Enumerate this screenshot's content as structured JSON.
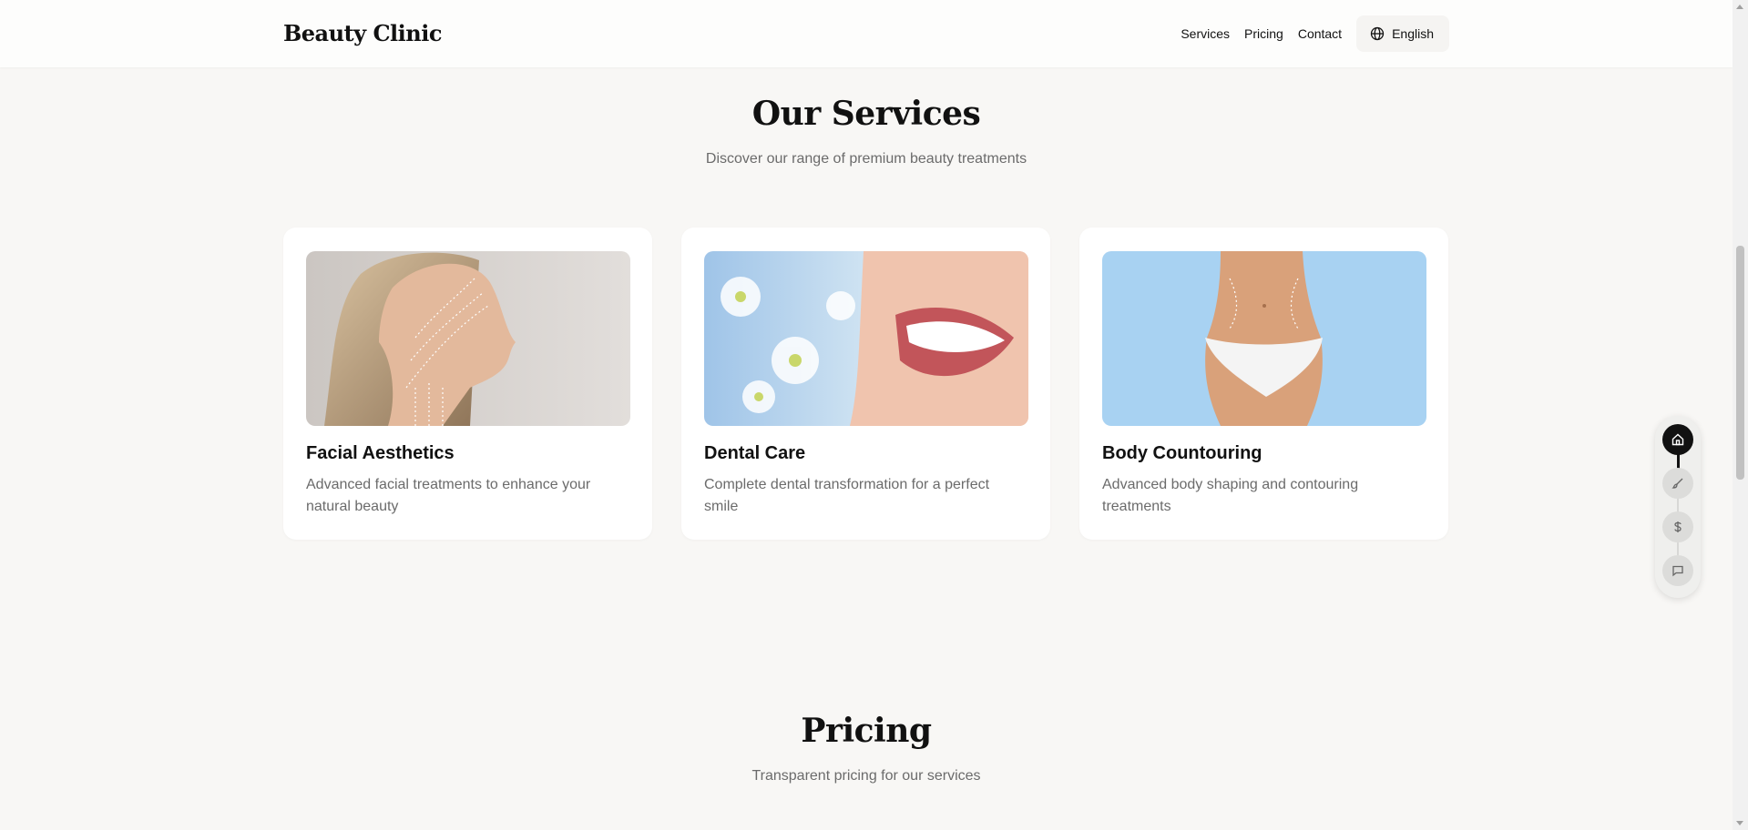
{
  "header": {
    "logo": "Beauty Clinic",
    "nav": [
      {
        "label": "Services"
      },
      {
        "label": "Pricing"
      },
      {
        "label": "Contact"
      }
    ],
    "language": "English"
  },
  "services": {
    "title": "Our Services",
    "subtitle": "Discover our range of premium beauty treatments",
    "cards": [
      {
        "title": "Facial Aesthetics",
        "description": "Advanced facial treatments to enhance your natural beauty",
        "image_icon": "face-profile-image"
      },
      {
        "title": "Dental Care",
        "description": "Complete dental transformation for a perfect smile",
        "image_icon": "smile-image"
      },
      {
        "title": "Body Countouring",
        "description": "Advanced body shaping and contouring treatments",
        "image_icon": "body-image"
      }
    ]
  },
  "pricing": {
    "title": "Pricing",
    "subtitle": "Transparent pricing for our services"
  },
  "sidenav": {
    "items": [
      {
        "icon": "home-icon",
        "active": true
      },
      {
        "icon": "brush-icon",
        "active": false
      },
      {
        "icon": "dollar-icon",
        "active": false
      },
      {
        "icon": "chat-icon",
        "active": false
      }
    ]
  },
  "colors": {
    "background": "#f8f7f5",
    "accent": "#111111",
    "muted_text": "#6b6b6b"
  }
}
